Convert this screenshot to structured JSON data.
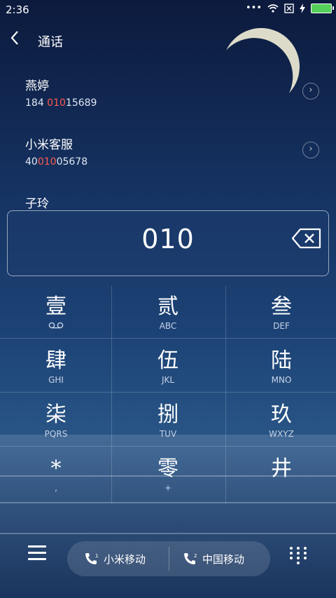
{
  "status_bar": {
    "time": "2:36",
    "dots": "•••"
  },
  "header": {
    "title": "通话"
  },
  "contacts": [
    {
      "name": "燕婷",
      "num_pre": "184 ",
      "num_hl": "010",
      "num_post": "15689"
    },
    {
      "name": "小米客服",
      "num_pre": "40",
      "num_hl": "010",
      "num_post": "05678"
    },
    {
      "name": "子玲",
      "num_pre": "",
      "num_hl": "",
      "num_post": ""
    }
  ],
  "dialer": {
    "typed_number": "010"
  },
  "keypad": [
    {
      "main": "壹",
      "sub": "voicemail"
    },
    {
      "main": "贰",
      "sub": "ABC"
    },
    {
      "main": "叁",
      "sub": "DEF"
    },
    {
      "main": "肆",
      "sub": "GHI"
    },
    {
      "main": "伍",
      "sub": "JKL"
    },
    {
      "main": "陆",
      "sub": "MNO"
    },
    {
      "main": "柒",
      "sub": "PQRS"
    },
    {
      "main": "捌",
      "sub": "TUV"
    },
    {
      "main": "玖",
      "sub": "WXYZ"
    },
    {
      "main": "*",
      "sub": ","
    },
    {
      "main": "零",
      "sub": "+"
    },
    {
      "main": "井",
      "sub": ""
    }
  ],
  "bottom": {
    "sim1_label": "小米移动",
    "sim1_number": "1",
    "sim2_label": "中国移动",
    "sim2_number": "2"
  },
  "colors": {
    "highlight": "#ff5a4e",
    "battery": "#54d05a"
  }
}
